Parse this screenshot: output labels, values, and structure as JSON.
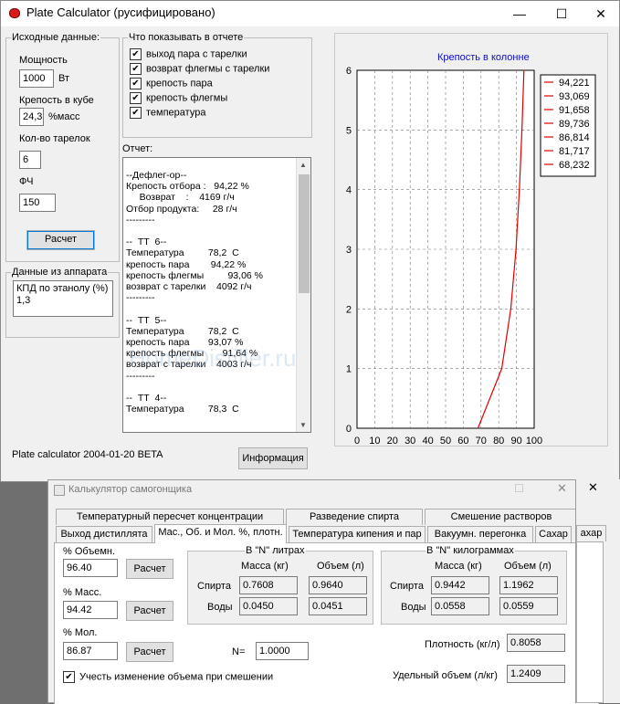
{
  "main": {
    "title": "Plate Calculator (русифицировано)",
    "win_minimize": "—",
    "win_maximize": "☐",
    "win_close": "✕",
    "input_group": {
      "legend": "Исходные данные:",
      "power_label": "Мощность",
      "power_value": "1000",
      "power_unit": "Вт",
      "cube_strength_label": "Крепость в кубе",
      "cube_strength_value": "24,3",
      "cube_strength_unit": "%масс",
      "plates_label": "Кол-во тарелок",
      "plates_value": "6",
      "fch_label": "ФЧ",
      "fch_value": "150",
      "calc_button": "Расчет"
    },
    "device_group": {
      "legend": "Данные из аппарата",
      "text_line1": "КПД по этанолу (%)",
      "text_line2": "1,3"
    },
    "show_group": {
      "legend": "Что показывать в отчете",
      "options": [
        {
          "label": "выход пара с тарелки",
          "checked": "✔"
        },
        {
          "label": "возврат флегмы с тарелки",
          "checked": "✔"
        },
        {
          "label": "крепость пара",
          "checked": "✔"
        },
        {
          "label": "крепость флегмы",
          "checked": "✔"
        },
        {
          "label": "температура",
          "checked": "✔"
        }
      ]
    },
    "report_label": "Отчет:",
    "report_text": "--Дефлег-ор--\nКрепость отбора :   94,22 %\n     Возврат    :    4169 г/ч\nОтбор продукта:     28 г/ч\n---------\n\n--  ТТ  6--\nТемпература         78,2  С\nкрепость пара        94,22 %\nкрепость флегмы         93,06 %\nвозврат с тарелки    4092 г/ч\n---------\n\n--  ТТ  5--\nТемпература         78,2  С\nкрепость пара       93,07 %\nкрепость флегмы       91,64 %\nвозврат с тарелки    4003 г/ч\n---------\n\n--  ТТ  4--\nТемпература         78,3  С",
    "version_text": "Plate calculator 2004-01-20 BETA",
    "info_button": "Информация",
    "watermark": "HomeDistiller.ru"
  },
  "chart_data": {
    "type": "line",
    "title": "Крепость в колонне",
    "xlim": [
      0,
      100
    ],
    "ylim": [
      0,
      6
    ],
    "xticks": [
      "0",
      "10",
      "20",
      "30",
      "40",
      "50",
      "60",
      "70",
      "80",
      "90",
      "100"
    ],
    "yticks": [
      "0",
      "1",
      "2",
      "3",
      "4",
      "5",
      "6"
    ],
    "grid": true,
    "legend_position": "right",
    "legend": [
      "94,221",
      "93,069",
      "91,658",
      "89,736",
      "86,814",
      "81,717",
      "68,232"
    ],
    "series": [
      {
        "x": [
          68.232,
          81.717,
          86.814,
          89.736,
          91.658,
          93.069,
          94.221
        ],
        "y": [
          0,
          1,
          2,
          3,
          4,
          5,
          6
        ],
        "color": "#e00000"
      }
    ]
  },
  "calc": {
    "title": "Калькулятор самогонщика",
    "tabs_row1": [
      "Температурный пересчет концентрации",
      "Разведение спирта",
      "Смешение растворов"
    ],
    "tabs_row2": [
      "Выход дистиллята",
      "Мас., Об. и Мол. %, плотн.",
      "Температура кипения и пар",
      "Вакуумн. перегонка",
      "Сахар"
    ],
    "vol_label": "% Объемн.",
    "vol_value": "96.40",
    "mass_label": "% Масс.",
    "mass_value": "94.42",
    "mol_label": "% Мол.",
    "mol_value": "86.87",
    "calc_button": "Расчет",
    "n_label": "N=",
    "n_value": "1.0000",
    "mix_checkbox": "Учесть изменение объема при смешении",
    "mix_checked": "✔",
    "liters": {
      "legend": "В \"N\" литрах",
      "col_mass": "Масса (кг)",
      "col_vol": "Объем (л)",
      "row_spirit": "Спирта",
      "row_water": "Воды",
      "spirit_mass": "0.7608",
      "spirit_vol": "0.9640",
      "water_mass": "0.0450",
      "water_vol": "0.0451"
    },
    "kilos": {
      "legend": "В \"N\" килограммах",
      "col_mass": "Масса (кг)",
      "col_vol": "Объем (л)",
      "row_spirit": "Спирта",
      "row_water": "Воды",
      "spirit_mass": "0.9442",
      "spirit_vol": "1.1962",
      "water_mass": "0.0558",
      "water_vol": "0.0559"
    },
    "density_label": "Плотность (кг/л)",
    "density_value": "0.8058",
    "specvol_label": "Удельный объем (л/кг)",
    "specvol_value": "1.2409"
  },
  "side": {
    "close": "✕",
    "tab": "ахар"
  }
}
